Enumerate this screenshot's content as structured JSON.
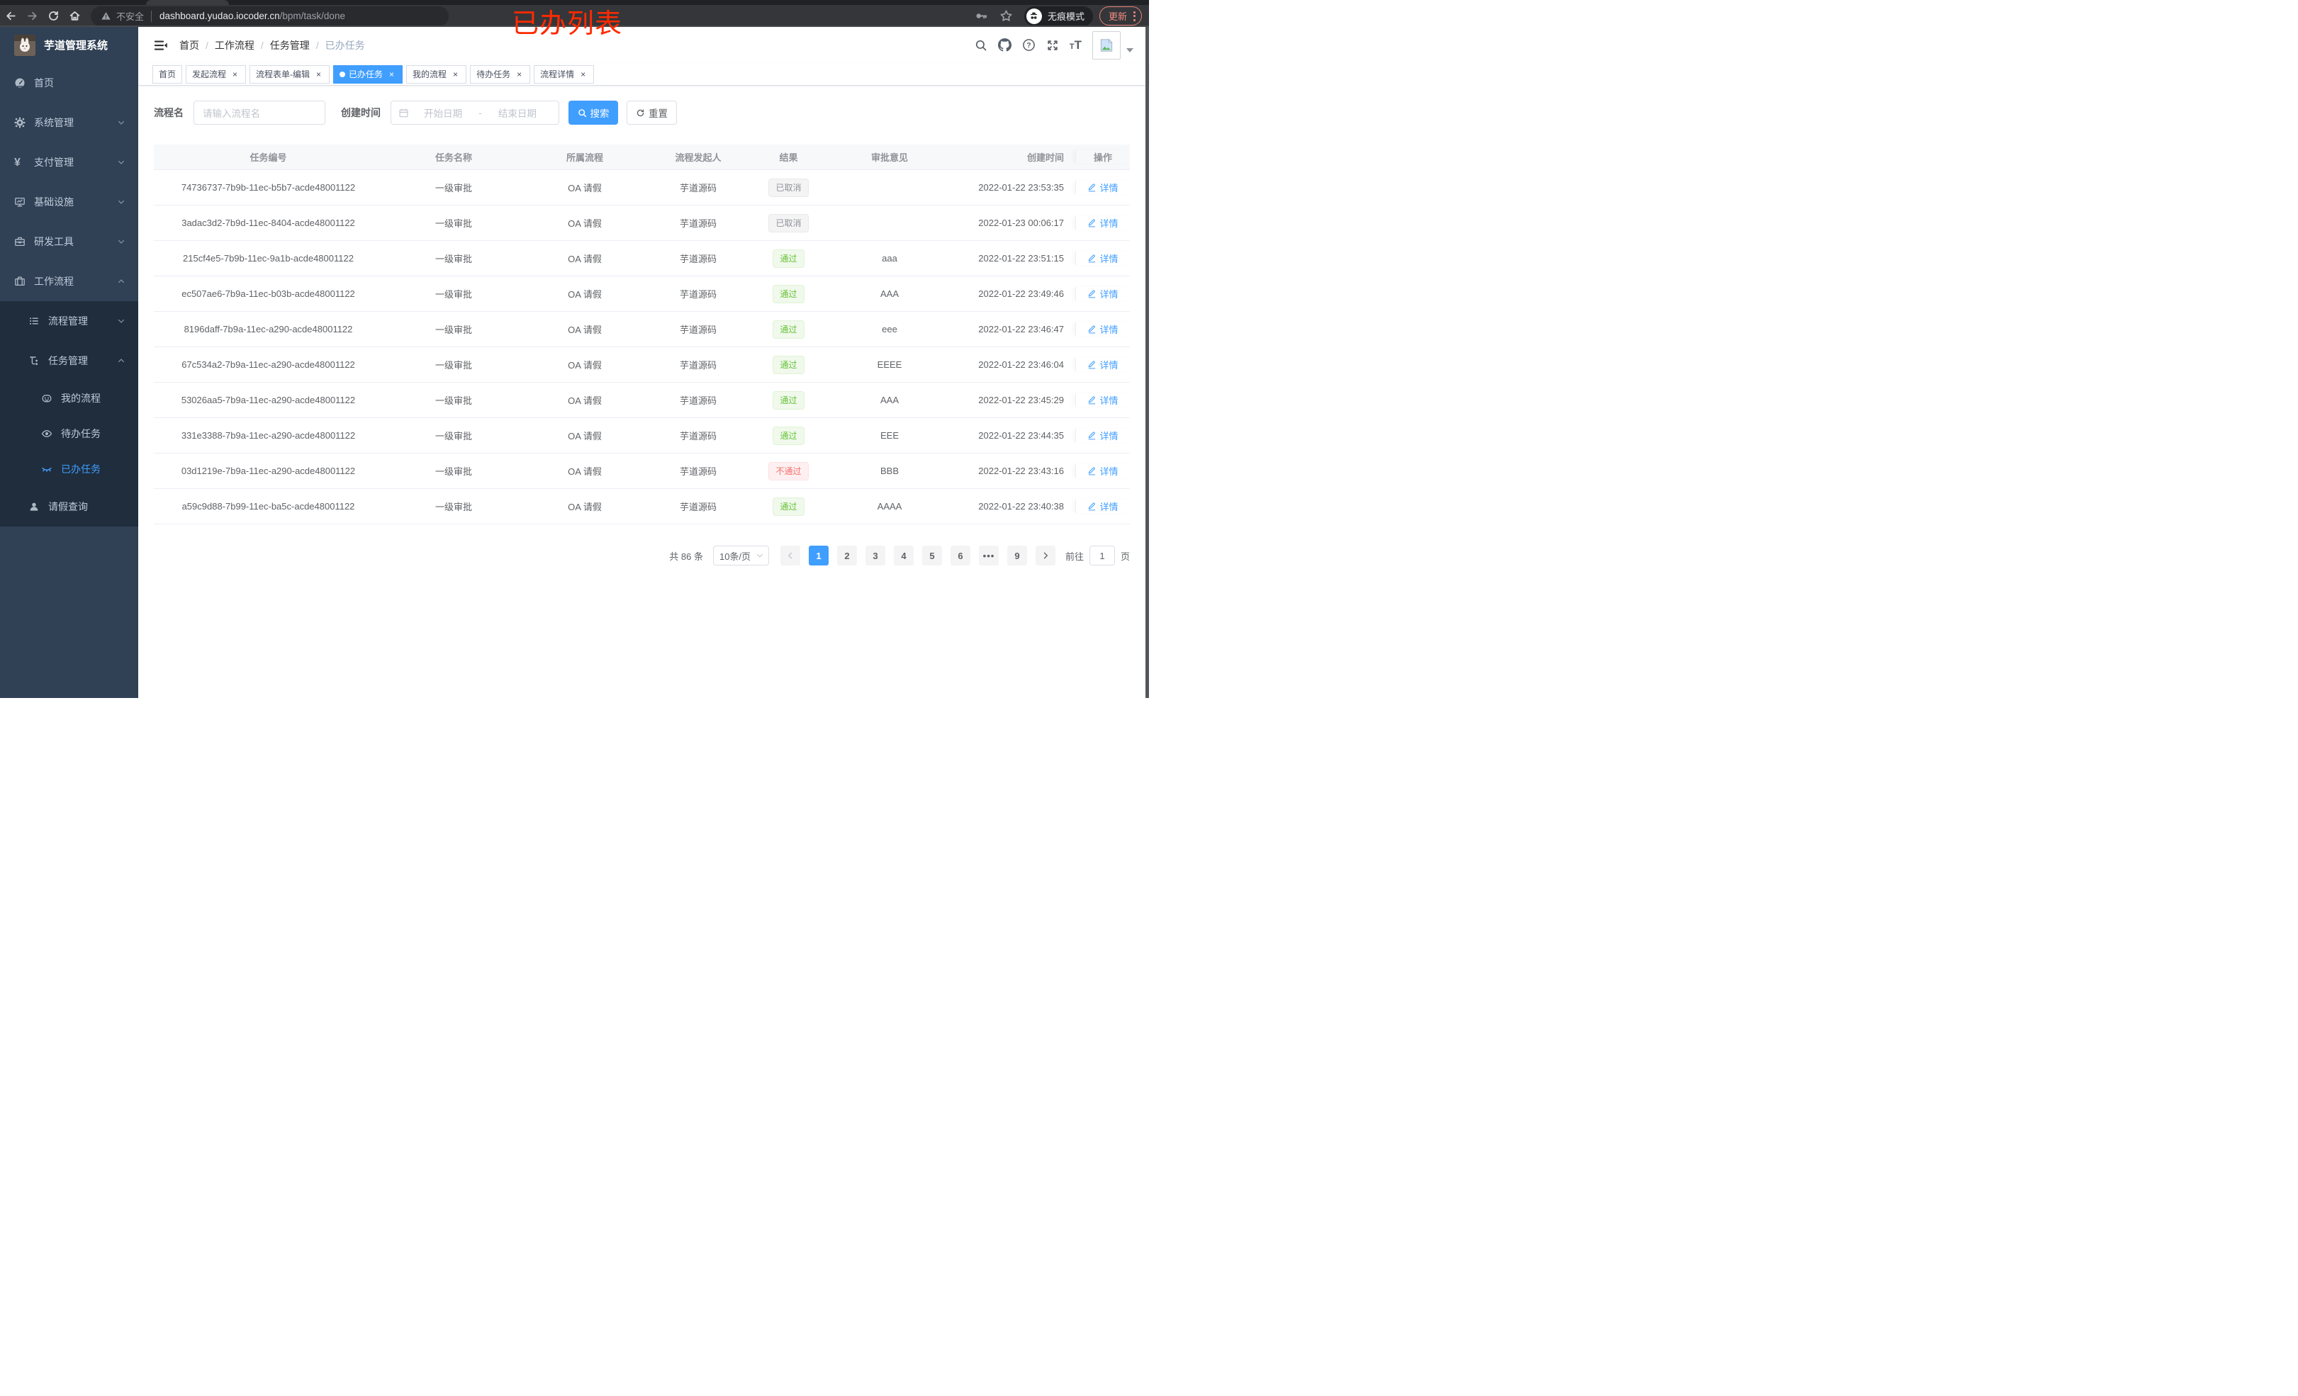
{
  "browser": {
    "security_label": "不安全",
    "url_host": "dashboard.yudao.iocoder.cn",
    "url_path": "/bpm/task/done",
    "incognito_label": "无痕模式",
    "update_label": "更新",
    "annotation": "已办列表",
    "colors": {
      "annotation": "#ff2a00",
      "update": "#f08c80"
    }
  },
  "sidebar": {
    "app_title": "芋道管理系统",
    "logo_icon": "rabbit-logo",
    "items": [
      {
        "label": "首页",
        "icon": "gauge-icon",
        "level": 1,
        "chevron": null,
        "active": false,
        "dark": false
      },
      {
        "label": "系统管理",
        "icon": "gear-icon",
        "level": 1,
        "chevron": "down",
        "active": false,
        "dark": false
      },
      {
        "label": "支付管理",
        "icon": "yen-icon",
        "level": 1,
        "chevron": "down",
        "active": false,
        "dark": false
      },
      {
        "label": "基础设施",
        "icon": "monitor-icon",
        "level": 1,
        "chevron": "down",
        "active": false,
        "dark": false
      },
      {
        "label": "研发工具",
        "icon": "toolbox-icon",
        "level": 1,
        "chevron": "down",
        "active": false,
        "dark": false
      },
      {
        "label": "工作流程",
        "icon": "briefcase-icon",
        "level": 1,
        "chevron": "up",
        "active": false,
        "dark": false
      },
      {
        "label": "流程管理",
        "icon": "list-icon",
        "level": 2,
        "chevron": "down",
        "active": false,
        "dark": true
      },
      {
        "label": "任务管理",
        "icon": "flow-icon",
        "level": 2,
        "chevron": "up",
        "active": false,
        "dark": true
      },
      {
        "label": "我的流程",
        "icon": "face-icon",
        "level": 3,
        "chevron": null,
        "active": false,
        "dark": true
      },
      {
        "label": "待办任务",
        "icon": "eye-open-icon",
        "level": 3,
        "chevron": null,
        "active": false,
        "dark": true
      },
      {
        "label": "已办任务",
        "icon": "eye-closed-icon",
        "level": 3,
        "chevron": null,
        "active": true,
        "dark": true
      },
      {
        "label": "请假查询",
        "icon": "user-icon",
        "level": 2,
        "chevron": null,
        "active": false,
        "dark": true
      }
    ]
  },
  "breadcrumb": [
    "首页",
    "工作流程",
    "任务管理",
    "已办任务"
  ],
  "tabs": [
    {
      "label": "首页",
      "active": false,
      "closable": false
    },
    {
      "label": "发起流程",
      "active": false,
      "closable": true
    },
    {
      "label": "流程表单-编辑",
      "active": false,
      "closable": true
    },
    {
      "label": "已办任务",
      "active": true,
      "closable": true
    },
    {
      "label": "我的流程",
      "active": false,
      "closable": true
    },
    {
      "label": "待办任务",
      "active": false,
      "closable": true
    },
    {
      "label": "流程详情",
      "active": false,
      "closable": true
    }
  ],
  "filters": {
    "name_label": "流程名",
    "name_placeholder": "请输入流程名",
    "time_label": "创建时间",
    "start_placeholder": "开始日期",
    "range_separator": "-",
    "end_placeholder": "结束日期",
    "search_label": "搜索",
    "reset_label": "重置"
  },
  "table": {
    "columns": [
      "任务编号",
      "任务名称",
      "所属流程",
      "流程发起人",
      "结果",
      "审批意见",
      "创建时间",
      "操作"
    ],
    "detail_label": "详情",
    "result_colors": {
      "success": "#67c23a",
      "danger": "#f56c6c",
      "info": "#909399",
      "accent": "#409eff"
    },
    "rows": [
      {
        "id": "74736737-7b9b-11ec-b5b7-acde48001122",
        "name": "一级审批",
        "process": "OA 请假",
        "starter": "芋道源码",
        "result": "已取消",
        "result_type": "info",
        "opinion": "",
        "time": "2022-01-22 23:53:35"
      },
      {
        "id": "3adac3d2-7b9d-11ec-8404-acde48001122",
        "name": "一级审批",
        "process": "OA 请假",
        "starter": "芋道源码",
        "result": "已取消",
        "result_type": "info",
        "opinion": "",
        "time": "2022-01-23 00:06:17"
      },
      {
        "id": "215cf4e5-7b9b-11ec-9a1b-acde48001122",
        "name": "一级审批",
        "process": "OA 请假",
        "starter": "芋道源码",
        "result": "通过",
        "result_type": "success",
        "opinion": "aaa",
        "time": "2022-01-22 23:51:15"
      },
      {
        "id": "ec507ae6-7b9a-11ec-b03b-acde48001122",
        "name": "一级审批",
        "process": "OA 请假",
        "starter": "芋道源码",
        "result": "通过",
        "result_type": "success",
        "opinion": "AAA",
        "time": "2022-01-22 23:49:46"
      },
      {
        "id": "8196daff-7b9a-11ec-a290-acde48001122",
        "name": "一级审批",
        "process": "OA 请假",
        "starter": "芋道源码",
        "result": "通过",
        "result_type": "success",
        "opinion": "eee",
        "time": "2022-01-22 23:46:47"
      },
      {
        "id": "67c534a2-7b9a-11ec-a290-acde48001122",
        "name": "一级审批",
        "process": "OA 请假",
        "starter": "芋道源码",
        "result": "通过",
        "result_type": "success",
        "opinion": "EEEE",
        "time": "2022-01-22 23:46:04"
      },
      {
        "id": "53026aa5-7b9a-11ec-a290-acde48001122",
        "name": "一级审批",
        "process": "OA 请假",
        "starter": "芋道源码",
        "result": "通过",
        "result_type": "success",
        "opinion": "AAA",
        "time": "2022-01-22 23:45:29"
      },
      {
        "id": "331e3388-7b9a-11ec-a290-acde48001122",
        "name": "一级审批",
        "process": "OA 请假",
        "starter": "芋道源码",
        "result": "通过",
        "result_type": "success",
        "opinion": "EEE",
        "time": "2022-01-22 23:44:35"
      },
      {
        "id": "03d1219e-7b9a-11ec-a290-acde48001122",
        "name": "一级审批",
        "process": "OA 请假",
        "starter": "芋道源码",
        "result": "不通过",
        "result_type": "danger",
        "opinion": "BBB",
        "time": "2022-01-22 23:43:16"
      },
      {
        "id": "a59c9d88-7b99-11ec-ba5c-acde48001122",
        "name": "一级审批",
        "process": "OA 请假",
        "starter": "芋道源码",
        "result": "通过",
        "result_type": "success",
        "opinion": "AAAA",
        "time": "2022-01-22 23:40:38"
      }
    ]
  },
  "pagination": {
    "total_label": "共 86 条",
    "page_size_label": "10条/页",
    "pages": [
      "1",
      "2",
      "3",
      "4",
      "5",
      "6",
      "•••",
      "9"
    ],
    "active_page": "1",
    "goto_label": "前往",
    "goto_value": "1",
    "page_unit": "页"
  }
}
